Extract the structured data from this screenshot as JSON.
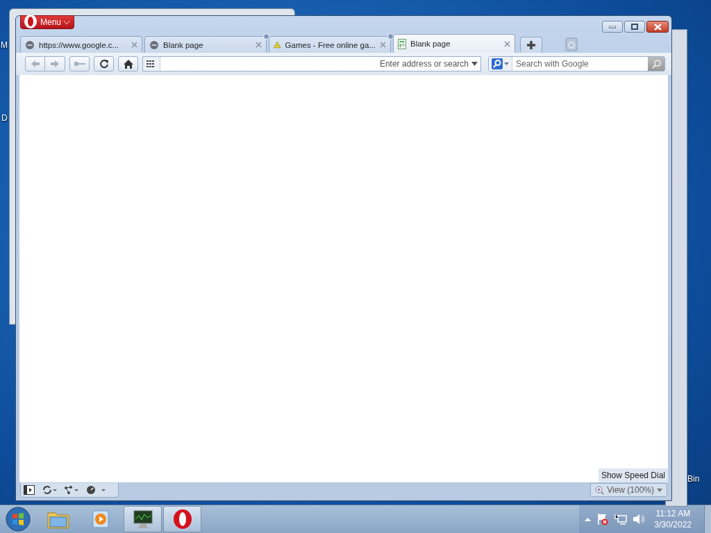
{
  "desktop": {
    "icon_labels": [
      "M",
      "D",
      "Bin"
    ]
  },
  "browser": {
    "menu_button": "Menu",
    "tabs": [
      {
        "title": "https://www.google.c...",
        "kind": "globe",
        "selected": false,
        "has_update": false
      },
      {
        "title": "Blank page",
        "kind": "globe",
        "selected": false,
        "has_update": true
      },
      {
        "title": "Games - Free online ga...",
        "kind": "games",
        "selected": false,
        "has_update": true
      },
      {
        "title": "Blank page",
        "kind": "page",
        "selected": true,
        "has_update": false
      }
    ],
    "address_field": {
      "placeholder": "Enter address or search"
    },
    "search_field": {
      "placeholder": "Search with Google"
    },
    "tooltip": "Show Speed Dial",
    "zoom_button": "View (100%)"
  },
  "taskbar": {
    "items": [
      {
        "kind": "explorer",
        "running": false
      },
      {
        "kind": "media",
        "running": false
      },
      {
        "kind": "monitor",
        "running": true
      },
      {
        "kind": "opera",
        "running": true
      }
    ],
    "clock": {
      "time": "11:12 AM",
      "date": "3/30/2022"
    }
  }
}
